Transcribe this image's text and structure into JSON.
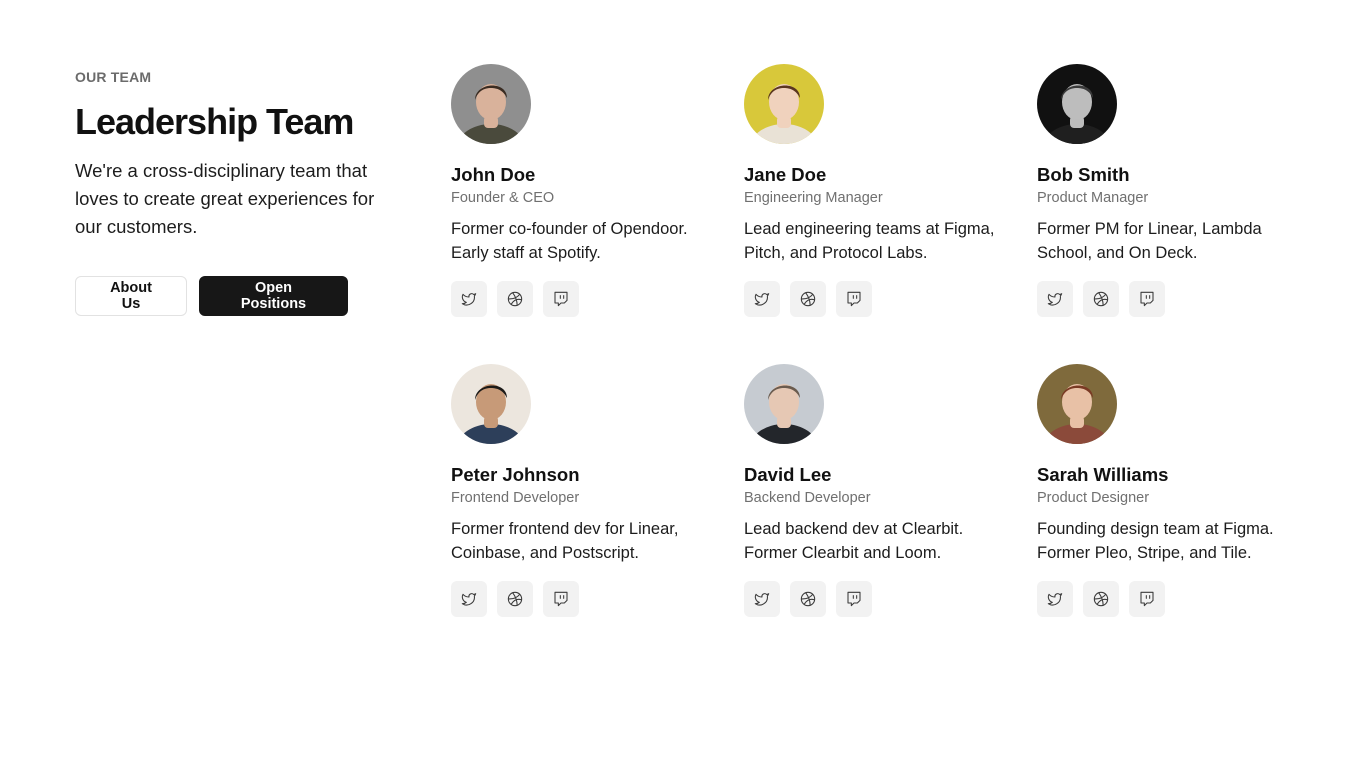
{
  "intro": {
    "eyebrow": "OUR TEAM",
    "title": "Leadership Team",
    "description": "We're a cross-disciplinary team that loves to create great experiences for our customers.",
    "about_label": "About Us",
    "positions_label": "Open Positions"
  },
  "icons": [
    "twitter-icon",
    "dribbble-icon",
    "twitch-icon"
  ],
  "colors": {
    "primary_button": "#171717",
    "social_button_bg": "#f2f2f2",
    "muted_text": "#707070"
  },
  "team": [
    {
      "name": "John Doe",
      "role": "Founder & CEO",
      "bio": "Former co-founder of Opendoor. Early staff at Spotify.",
      "avatar_bg": "#8f8f8f",
      "skin": "#d9b29b",
      "hair": "#3a2c22",
      "shirt": "#4a4a3c"
    },
    {
      "name": "Jane Doe",
      "role": "Engineering Manager",
      "bio": "Lead engineering teams at Figma, Pitch, and Protocol Labs.",
      "avatar_bg": "#d8c83a",
      "skin": "#f0d2bd",
      "hair": "#5a3620",
      "shirt": "#e9e2d6"
    },
    {
      "name": "Bob Smith",
      "role": "Product Manager",
      "bio": "Former PM for Linear, Lambda School, and On Deck.",
      "avatar_bg": "#111111",
      "skin": "#bdbdbd",
      "hair": "#3b3b3b",
      "shirt": "#1f1f1f"
    },
    {
      "name": "Peter Johnson",
      "role": "Frontend Developer",
      "bio": "Former frontend dev for Linear, Coinbase, and Postscript.",
      "avatar_bg": "#ece6de",
      "skin": "#c79a78",
      "hair": "#1c1a18",
      "shirt": "#2d3f5a"
    },
    {
      "name": "David Lee",
      "role": "Backend Developer",
      "bio": "Lead backend dev at Clearbit. Former Clearbit and Loom.",
      "avatar_bg": "#c6cbd1",
      "skin": "#e6c8b4",
      "hair": "#6a5b4e",
      "shirt": "#23262b"
    },
    {
      "name": "Sarah Williams",
      "role": "Product Designer",
      "bio": "Founding design team at Figma. Former Pleo, Stripe, and Tile.",
      "avatar_bg": "#7f6a3c",
      "skin": "#e8c1a6",
      "hair": "#7a3a24",
      "shirt": "#8b4a3a"
    }
  ]
}
